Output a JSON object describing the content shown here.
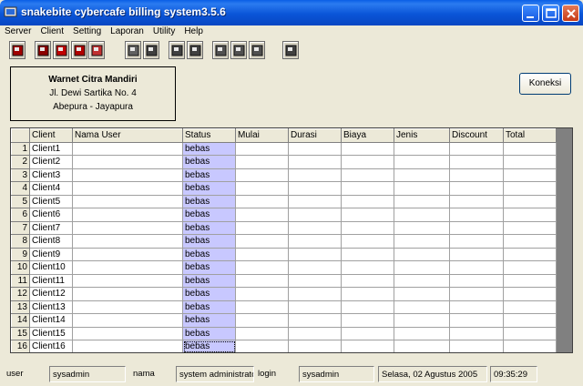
{
  "window": {
    "title": "snakebite cybercafe billing system3.5.6",
    "minimize_label": "minimize",
    "maximize_label": "maximize",
    "close_label": "close"
  },
  "menu": [
    "Server",
    "Client",
    "Setting",
    "Laporan",
    "Utility",
    "Help"
  ],
  "toolbar": {
    "icons": [
      "exit-icon",
      "register-icon",
      "record-icon",
      "reset-icon",
      "alarm-icon",
      "report-icon",
      "database-icon",
      "edit-icon",
      "calculator-icon",
      "copy-icon",
      "stop-icon",
      "message-icon",
      "network-icon"
    ]
  },
  "info": {
    "name": "Warnet Citra Mandiri",
    "address": "Jl. Dewi Sartika No. 4",
    "city": "Abepura - Jayapura"
  },
  "koneksi_label": "Koneksi",
  "grid": {
    "columns": [
      "Client",
      "Nama User",
      "Status",
      "Mulai",
      "Durasi",
      "Biaya",
      "Jenis",
      "Discount",
      "Total"
    ],
    "rows": [
      {
        "no": "1",
        "client": "Client1",
        "status": "bebas"
      },
      {
        "no": "2",
        "client": "Client2",
        "status": "bebas"
      },
      {
        "no": "3",
        "client": "Client3",
        "status": "bebas"
      },
      {
        "no": "4",
        "client": "Client4",
        "status": "bebas"
      },
      {
        "no": "5",
        "client": "Client5",
        "status": "bebas"
      },
      {
        "no": "6",
        "client": "Client6",
        "status": "bebas"
      },
      {
        "no": "7",
        "client": "Client7",
        "status": "bebas"
      },
      {
        "no": "8",
        "client": "Client8",
        "status": "bebas"
      },
      {
        "no": "9",
        "client": "Client9",
        "status": "bebas"
      },
      {
        "no": "10",
        "client": "Client10",
        "status": "bebas"
      },
      {
        "no": "11",
        "client": "Client11",
        "status": "bebas"
      },
      {
        "no": "12",
        "client": "Client12",
        "status": "bebas"
      },
      {
        "no": "13",
        "client": "Client13",
        "status": "bebas"
      },
      {
        "no": "14",
        "client": "Client14",
        "status": "bebas"
      },
      {
        "no": "15",
        "client": "Client15",
        "status": "bebas"
      },
      {
        "no": "16",
        "client": "Client16",
        "status": "bebas"
      }
    ]
  },
  "statusbar": {
    "user_label": "user",
    "user_value": "sysadmin",
    "nama_label": "nama",
    "nama_value": "system administrato",
    "login_label": "login",
    "login_value": "sysadmin",
    "date": "Selasa, 02 Agustus 2005",
    "time": "09:35:29"
  },
  "colors": {
    "titlebar": "#0a55d8",
    "status_highlight": "#c8c8ff",
    "window_bg": "#ece9d8"
  }
}
